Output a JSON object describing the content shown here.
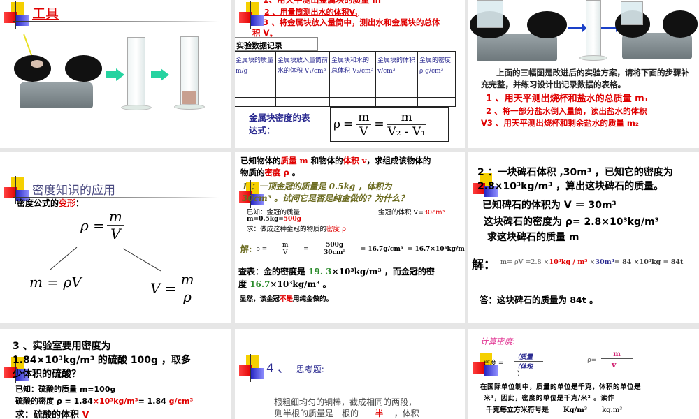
{
  "slides": {
    "s1": {
      "title": "工具"
    },
    "s2": {
      "step1": "1、用天平测出金属块的质量 m",
      "step2": "2 、用量筒测出水的体积V",
      "step2_sub": "1",
      "step3": "3 、将金属块放入量筒中，测出水和金属块的总体",
      "step3b": "积 V",
      "step3b_sub": "2",
      "table_caption": "实验数据记录",
      "columns": [
        "金属块的质量 m/g",
        "金属块放入量筒前水的体积 V₁/cm³",
        "金属块和水的总体积 V₂/cm³",
        "金属块的体积 v/cm³",
        "金属的密度 ρ g/cm³"
      ],
      "formula_label": "金属块密度的表达式：",
      "rho": "ρ",
      "m": "m",
      "V": "V",
      "V2": "V₂ - V₁"
    },
    "s3": {
      "desc": "上面的三幅图是改进后的实验方案，请将下面的步骤补充完整，并练习设计出记录数据的表格。",
      "step1": "1 、用天平测出烧杯和盐水的总质量 m₁",
      "step2": "2 、将一部分盐水倒入量筒，读出盐水的体积",
      "step3": "V3 、用天平测出烧杯和剩余盐水的质量 m₂"
    },
    "s4": {
      "title": "密度知识的应用",
      "subtitle_a": "密度公式的",
      "subtitle_b": "变形",
      "subtitle_c": "：",
      "f1_lhs": "ρ =",
      "f1_num": "m",
      "f1_den": "V",
      "f2": "m = ρV",
      "f3_lhs": "V =",
      "f3_num": "m",
      "f3_den": "ρ"
    },
    "s5": {
      "intro_1": "已知物体的",
      "intro_mass": "质量 m",
      "intro_2": " 和物体的",
      "intro_vol": "体积 v",
      "intro_3": "，求组成该物体的",
      "intro_4": "物质的",
      "intro_rho": "密度 ρ",
      "intro_5": " 。",
      "q": "1 ：一顶金冠的质量是 0.5kg ，体积为",
      "q2": "30cm³ 。试问它是否是纯金做的？为什么？",
      "given1": "已知：金冠的质量",
      "given_v": "金冠的体积 V=",
      "given_v_val": "30cm³",
      "given2a": "m=0.5kg=",
      "given2b": "500g",
      "find_a": "求：做成这种金冠的物质的",
      "find_b": "密度 ρ",
      "sol_label": "解:",
      "sol_rho": "ρ =",
      "sol_m": "m",
      "sol_v": "V",
      "sol_num": "500g",
      "sol_den": "30cm³",
      "sol_r1": "= 16.7g/cm³",
      "sol_r2": "= 16.7×10³kg/m³",
      "lookup_a": "查表：金的密度是 ",
      "lookup_gold": "19. 3",
      "lookup_b": "×10³kg/m³ ，而金冠的密",
      "lookup_c": "度 ",
      "lookup_crown": "16.7",
      "lookup_d": "×10³kg/m³ 。",
      "concl_a": "显然，该金冠",
      "concl_b": "不是",
      "concl_c": "用纯金做的。"
    },
    "s6": {
      "q1": "2 ：一块碑石体积 ,30m³ ，已知它的密度为",
      "q2": "2.8×10³kg/m³ ，算出这块碑石的质量。",
      "g1": "已知碑石的体积为 V ＝  30m³",
      "g2": "这块碑石的密度为 ρ= 2.8×10³kg/m³",
      "g3": "求这块碑石的质量 m",
      "sol_label": "解：",
      "sol_a": "m= ρV  =2.8 ×",
      "sol_b": "10³kg / m³",
      "sol_c": " ×",
      "sol_d": "30m³",
      "sol_e": "= 84 ×10³kg  =  84t",
      "ans": "答：这块碑石的质量为 84t 。"
    },
    "s7": {
      "q1": "3 、实验室要用密度为",
      "q2": "1.84×10³kg/m³ 的硫酸 100g ，取多",
      "q3": "少体积的硫酸？",
      "g1": "已知：硫酸的质量 m=100g",
      "g2a": "硫酸的密度 ρ = 1.84",
      "g2b": "×10³kg/m³",
      "g2c": "= 1.84 ",
      "g2d": "g/cm³",
      "g3a": "求：硫酸的体积 ",
      "g3b": "V"
    },
    "s8": {
      "title_num": "4 、",
      "title": "思考题:",
      "l1": "一根粗细均匀的铜棒，截成相同的两段，",
      "l2a": "则半根的质量是一根的",
      "l2b": "一半",
      "l2c": "，体积"
    },
    "s9": {
      "title": "计算密度:",
      "lhs": "密度 =",
      "num": "（质量",
      "den": "（体积",
      "rp": "）",
      "rho": "ρ=",
      "m": "m",
      "v": "v",
      "p1": "在国际单位制中，质量的单位是千克，体积的单位是",
      "p2": "米³，因此，密度的单位是千克/米³  。读作",
      "p3": "千克每立方米符号是",
      "p3b": "Kg/m³",
      "p3c": "kg.m³"
    }
  }
}
